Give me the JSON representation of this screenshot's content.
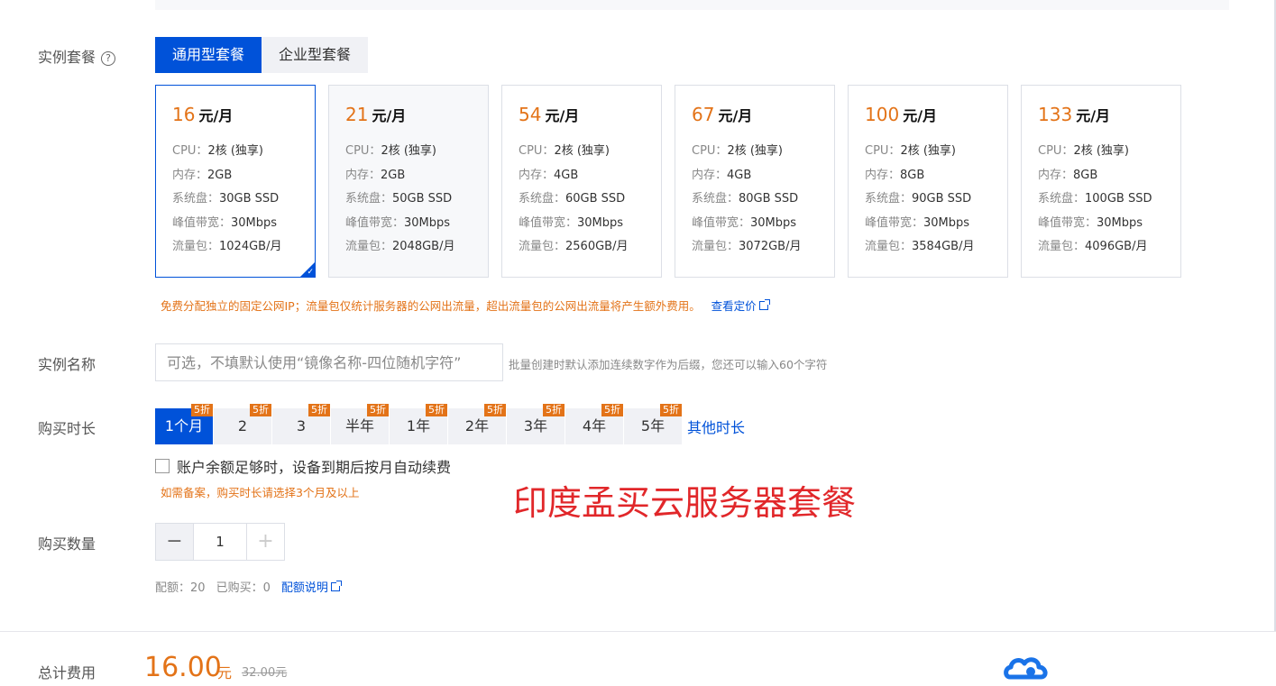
{
  "labels": {
    "instance_package": "实例套餐",
    "instance_name": "实例名称",
    "purchase_duration": "购买时长",
    "purchase_quantity": "购买数量",
    "total_cost": "总计费用"
  },
  "package_tabs": [
    {
      "label": "通用型套餐",
      "active": true
    },
    {
      "label": "企业型套餐",
      "active": false
    }
  ],
  "plans": [
    {
      "price": "16",
      "unit": "元/月",
      "cpu": "2核 (独享)",
      "memory": "2GB",
      "disk": "30GB SSD",
      "bandwidth": "30Mbps",
      "traffic": "1024GB/月",
      "selected": true
    },
    {
      "price": "21",
      "unit": "元/月",
      "cpu": "2核 (独享)",
      "memory": "2GB",
      "disk": "50GB SSD",
      "bandwidth": "30Mbps",
      "traffic": "2048GB/月",
      "selected": false
    },
    {
      "price": "54",
      "unit": "元/月",
      "cpu": "2核 (独享)",
      "memory": "4GB",
      "disk": "60GB SSD",
      "bandwidth": "30Mbps",
      "traffic": "2560GB/月",
      "selected": false
    },
    {
      "price": "67",
      "unit": "元/月",
      "cpu": "2核 (独享)",
      "memory": "4GB",
      "disk": "80GB SSD",
      "bandwidth": "30Mbps",
      "traffic": "3072GB/月",
      "selected": false
    },
    {
      "price": "100",
      "unit": "元/月",
      "cpu": "2核 (独享)",
      "memory": "8GB",
      "disk": "90GB SSD",
      "bandwidth": "30Mbps",
      "traffic": "3584GB/月",
      "selected": false
    },
    {
      "price": "133",
      "unit": "元/月",
      "cpu": "2核 (独享)",
      "memory": "8GB",
      "disk": "100GB SSD",
      "bandwidth": "30Mbps",
      "traffic": "4096GB/月",
      "selected": false
    }
  ],
  "spec_keys": {
    "cpu": "CPU：",
    "memory": "内存：",
    "disk": "系统盘：",
    "bandwidth": "峰值带宽：",
    "traffic": "流量包："
  },
  "notice": {
    "text": "免费分配独立的固定公网IP；流量包仅统计服务器的公网出流量，超出流量包的公网出流量将产生额外费用。",
    "link": "查看定价"
  },
  "instance_name": {
    "placeholder": "可选，不填默认使用“镜像名称-四位随机字符”",
    "hint": "批量创建时默认添加连续数字作为后缀，您还可以输入60个字符"
  },
  "durations": [
    {
      "label": "1个月",
      "badge": "5折",
      "active": true
    },
    {
      "label": "2",
      "badge": "5折",
      "active": false
    },
    {
      "label": "3",
      "badge": "5折",
      "active": false
    },
    {
      "label": "半年",
      "badge": "5折",
      "active": false
    },
    {
      "label": "1年",
      "badge": "5折",
      "active": false
    },
    {
      "label": "2年",
      "badge": "5折",
      "active": false
    },
    {
      "label": "3年",
      "badge": "5折",
      "active": false
    },
    {
      "label": "4年",
      "badge": "5折",
      "active": false
    },
    {
      "label": "5年",
      "badge": "5折",
      "active": false
    }
  ],
  "other_duration": "其他时长",
  "auto_renew": {
    "label": "账户余额足够时，设备到期后按月自动续费",
    "checked": false
  },
  "backup_note": "如需备案，购买时长请选择3个月及以上",
  "watermark": "印度孟买云服务器套餐",
  "quantity": {
    "value": "1",
    "minus": "−",
    "plus": "+"
  },
  "quota": {
    "quota_label": "配额：",
    "quota_value": "20",
    "bought_label": "已购买：",
    "bought_value": "0",
    "link": "配额说明"
  },
  "total": {
    "price": "16.00",
    "unit": "元",
    "original": "32.00元"
  },
  "colors": {
    "primary": "#0052d9",
    "accent": "#e37318",
    "watermark": "#e1272a"
  }
}
